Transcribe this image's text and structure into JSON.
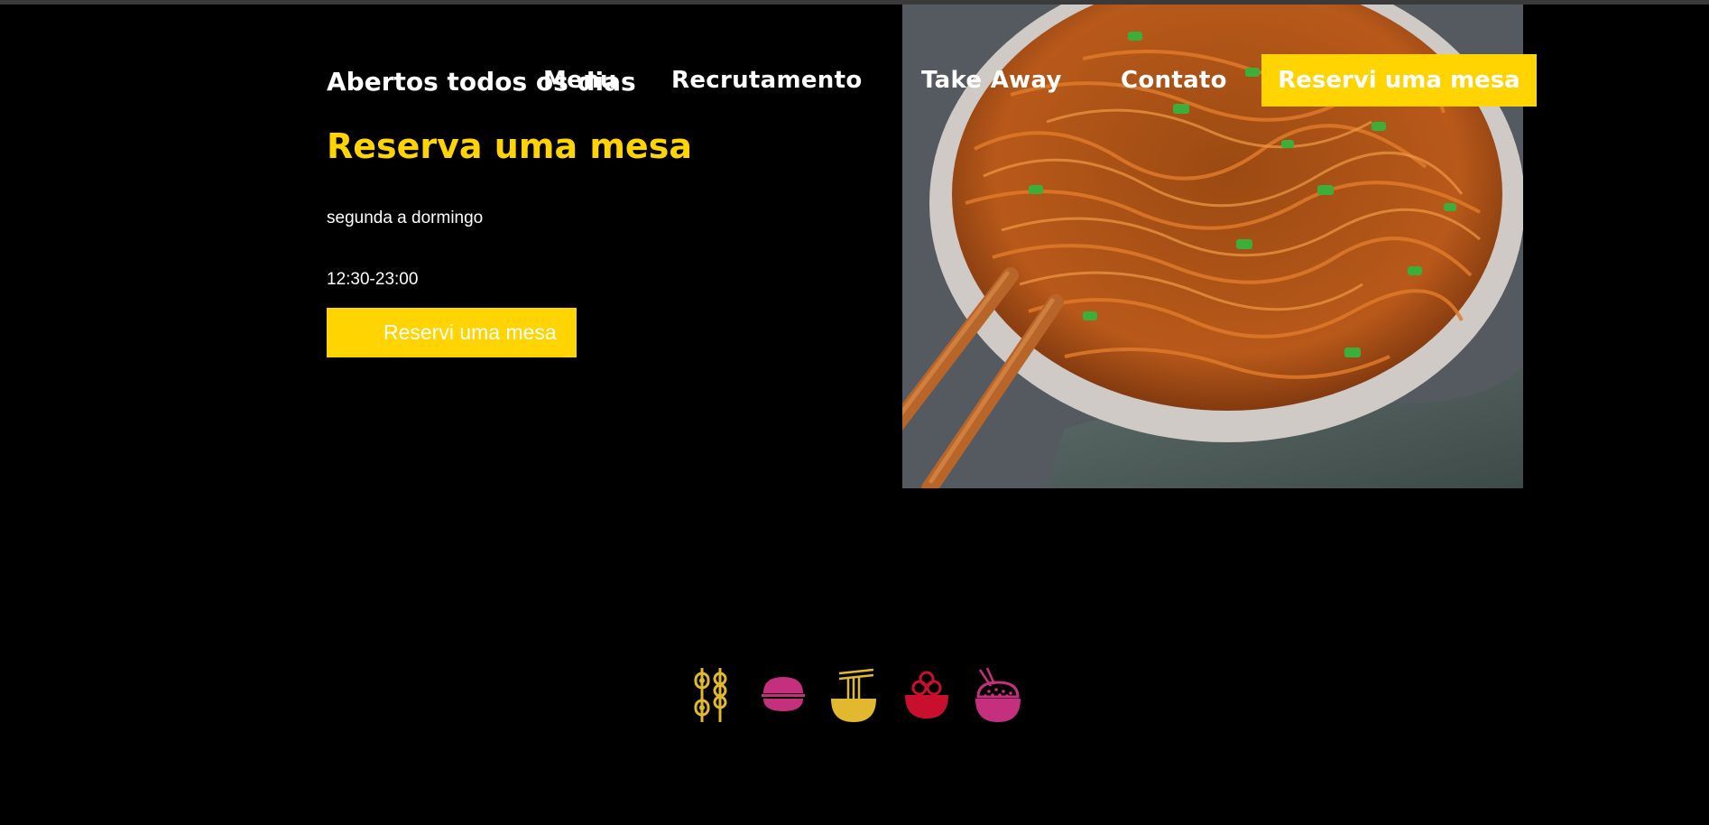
{
  "nav": {
    "items": [
      {
        "label": "Menu"
      },
      {
        "label": "Recrutamento"
      },
      {
        "label": "Take Away"
      },
      {
        "label": "Contato"
      }
    ],
    "cta_label": "Reservi uma mesa"
  },
  "hero": {
    "overlap_text": "Abertos todos os dias",
    "title": "Reserva uma mesa",
    "days": "segunda a dormingo",
    "hours": "12:30-23:00",
    "cta_label": "Reservi uma mesa"
  },
  "colors": {
    "accent": "#ffd400",
    "background": "#000000",
    "icon_yellow": "#e2b92e",
    "icon_pink": "#c4307e",
    "icon_red": "#c8102e"
  },
  "icons": [
    {
      "name": "skewer-icon"
    },
    {
      "name": "bao-icon"
    },
    {
      "name": "noodle-bowl-icon"
    },
    {
      "name": "ramen-bowl-icon"
    },
    {
      "name": "rice-bowl-icon"
    }
  ]
}
